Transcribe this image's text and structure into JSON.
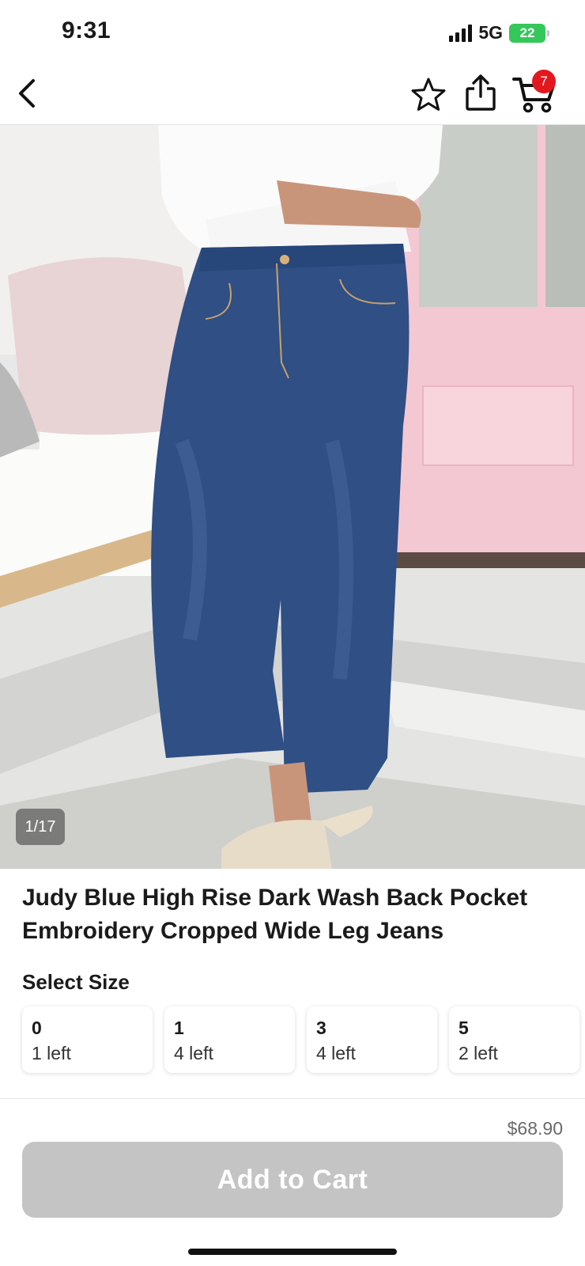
{
  "status_bar": {
    "time": "9:31",
    "network": "5G",
    "battery": "22"
  },
  "nav": {
    "cart_count": "7",
    "icons": [
      "back-icon",
      "star-icon",
      "share-icon",
      "cart-icon"
    ]
  },
  "gallery": {
    "counter": "1/17"
  },
  "product": {
    "title": "Judy Blue High Rise Dark Wash Back Pocket Embroidery Cropped Wide Leg Jeans",
    "size_label": "Select Size",
    "sizes": [
      {
        "size": "0",
        "stock": "1 left"
      },
      {
        "size": "1",
        "stock": "4 left"
      },
      {
        "size": "3",
        "stock": "4 left"
      },
      {
        "size": "5",
        "stock": "2 left"
      }
    ],
    "price": "$68.90"
  },
  "footer": {
    "add_to_cart_label": "Add to Cart"
  },
  "colors": {
    "badge": "#e3181f",
    "battery": "#34c759",
    "button_disabled": "#c4c4c4",
    "denim": "#2f4f85"
  }
}
